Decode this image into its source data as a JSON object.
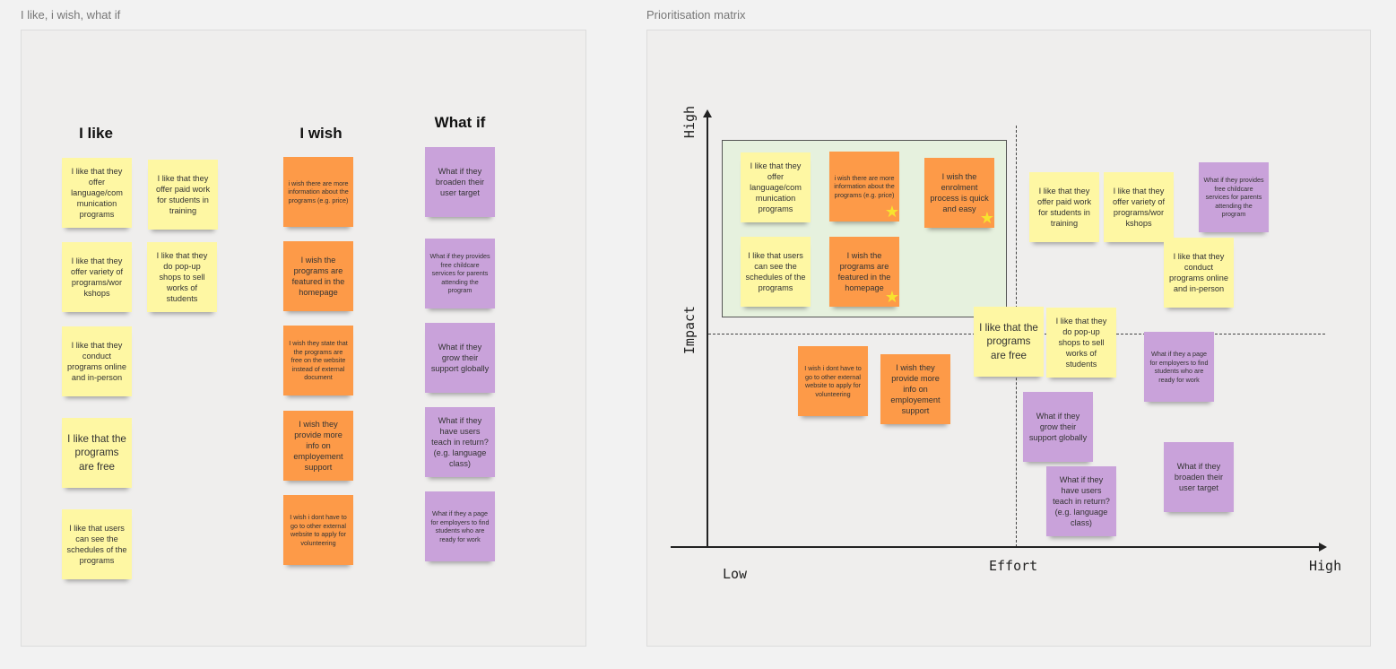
{
  "frames": {
    "left_title": "I like, i wish, what if",
    "right_title": "Prioritisation matrix"
  },
  "columns": {
    "like": "I like",
    "wish": "I wish",
    "whatif": "What if"
  },
  "colors": {
    "yellow": "#fef7a3",
    "orange": "#fd9a48",
    "purple": "#c9a2da",
    "matrix_highlight": "#e6f1de"
  },
  "left_notes": [
    {
      "text": "I like that they offer language/com munication programs",
      "color": "yellow"
    },
    {
      "text": "I like that they offer paid work for students in training",
      "color": "yellow"
    },
    {
      "text": "I like that they offer variety of programs/wor kshops",
      "color": "yellow"
    },
    {
      "text": "I like that they do pop-up shops to sell works of students",
      "color": "yellow"
    },
    {
      "text": "I like that they conduct programs online and in-person",
      "color": "yellow"
    },
    {
      "text": "I like that the programs are free",
      "color": "yellow"
    },
    {
      "text": "I like that users can see the schedules of the programs",
      "color": "yellow"
    },
    {
      "text": "i wish there are more information about the programs (e.g. price)",
      "color": "orange"
    },
    {
      "text": "I wish the programs are featured in the homepage",
      "color": "orange"
    },
    {
      "text": "I wish they state that the programs are free on the website instead of external document",
      "color": "orange"
    },
    {
      "text": "I wish they provide more info on employement support",
      "color": "orange"
    },
    {
      "text": "I wish i dont have to go to other external website to apply for volunteering",
      "color": "orange"
    },
    {
      "text": "What if they broaden their user target",
      "color": "purple"
    },
    {
      "text": "What if they provides free childcare services for parents attending the program",
      "color": "purple"
    },
    {
      "text": "What if they grow their support globally",
      "color": "purple"
    },
    {
      "text": "What if they have users teach in return? (e.g. language class)",
      "color": "purple"
    },
    {
      "text": "What if they a page for employers to find students who are ready for work",
      "color": "purple"
    }
  ],
  "matrix": {
    "y_axis": {
      "label": "Impact",
      "high": "High"
    },
    "x_axis": {
      "label": "Effort",
      "low": "Low",
      "high": "High"
    },
    "notes": [
      {
        "text": "I like that they offer language/com munication programs",
        "color": "yellow",
        "starred": false
      },
      {
        "text": "i wish there are more information about the programs (e.g. price)",
        "color": "orange",
        "starred": true
      },
      {
        "text": "I wish the enrolment process is quick and easy",
        "color": "orange",
        "starred": true
      },
      {
        "text": "I like that users can see the schedules of the programs",
        "color": "yellow",
        "starred": false
      },
      {
        "text": "I wish the programs are featured in the homepage",
        "color": "orange",
        "starred": true
      },
      {
        "text": "I like that they offer paid work for students in training",
        "color": "yellow",
        "starred": false
      },
      {
        "text": "I like that they offer variety of programs/wor kshops",
        "color": "yellow",
        "starred": false
      },
      {
        "text": "What if they provides free childcare services for parents attending the program",
        "color": "purple",
        "starred": false
      },
      {
        "text": "I like that they conduct programs online and in-person",
        "color": "yellow",
        "starred": false
      },
      {
        "text": "I like that the programs are free",
        "color": "yellow",
        "starred": false
      },
      {
        "text": "I like that they do pop-up shops to sell works of students",
        "color": "yellow",
        "starred": false
      },
      {
        "text": "What if they a page for employers to find students who are ready for work",
        "color": "purple",
        "starred": false
      },
      {
        "text": "I wish i dont have to go to other external website to apply for volunteering",
        "color": "orange",
        "starred": false
      },
      {
        "text": "I wish they provide more info on employement support",
        "color": "orange",
        "starred": false
      },
      {
        "text": "What if they grow their support globally",
        "color": "purple",
        "starred": false
      },
      {
        "text": "What if they broaden their user target",
        "color": "purple",
        "starred": false
      },
      {
        "text": "What if they have users teach in return? (e.g. language class)",
        "color": "purple",
        "starred": false
      }
    ]
  }
}
